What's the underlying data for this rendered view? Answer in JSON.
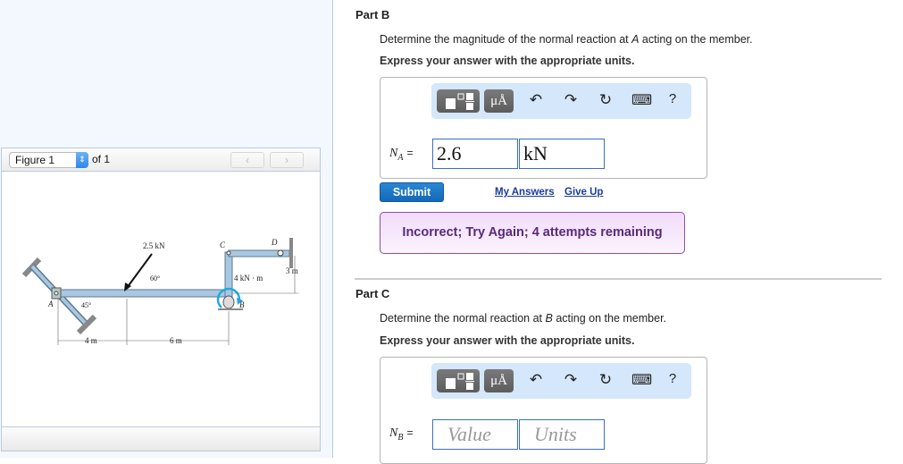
{
  "figure_panel": {
    "selector_value": "Figure 1",
    "of_label": "of 1",
    "prev_icon": "‹",
    "next_icon": "›",
    "diagram": {
      "force_label": "2.5 kN",
      "angle_force": "60°",
      "angle_support": "45°",
      "moment_label": "4 kN · m",
      "dim_left": "4 m",
      "dim_mid": "6 m",
      "dim_right": "3 m",
      "point_a": "A",
      "point_b": "B",
      "point_c": "C",
      "point_d": "D"
    }
  },
  "part_b": {
    "title": "Part B",
    "prompt_pre": "Determine the magnitude of the normal reaction at ",
    "prompt_var": "A",
    "prompt_post": " acting on the member.",
    "instruction": "Express your answer with the appropriate units.",
    "label_var": "N",
    "label_sub": "A",
    "label_eq": "=",
    "value": "2.6",
    "units": "kN",
    "submit_label": "Submit",
    "my_answers_label": "My Answers",
    "give_up_label": "Give Up",
    "feedback": "Incorrect; Try Again; 4 attempts remaining"
  },
  "part_c": {
    "title": "Part C",
    "prompt_pre": "Determine the normal reaction at ",
    "prompt_var": "B",
    "prompt_post": " acting on the member.",
    "instruction": "Express your answer with the appropriate units.",
    "label_var": "N",
    "label_sub": "B",
    "label_eq": "=",
    "value_placeholder": "Value",
    "units_placeholder": "Units"
  },
  "toolbar": {
    "units_button": "μÅ",
    "undo_icon": "↶",
    "redo_icon": "↷",
    "reset_icon": "↻",
    "keyboard_icon": "⌨",
    "help_icon": "?"
  },
  "colors": {
    "submit": "#1a76c7",
    "feedback_bg": "#f3e0fb",
    "feedback_text": "#5a2a78",
    "toolbar_bg": "#d4e7fb",
    "field_border": "#3a6fbf",
    "moment_arrow": "#1fa8e0"
  }
}
